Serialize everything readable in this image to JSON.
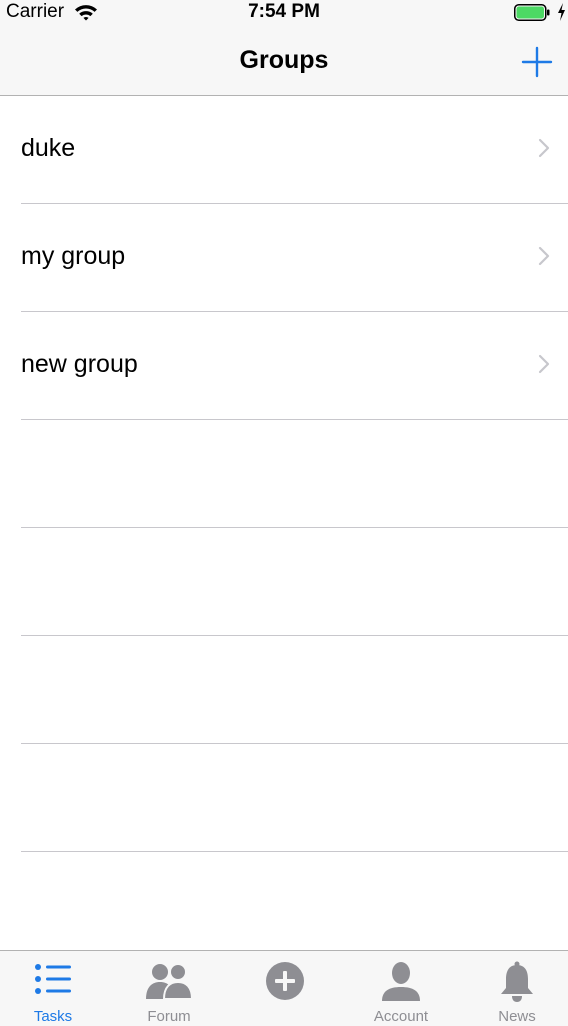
{
  "status_bar": {
    "carrier": "Carrier",
    "time": "7:54 PM"
  },
  "nav": {
    "title": "Groups",
    "add_icon": "plus-icon"
  },
  "groups": [
    {
      "name": "duke"
    },
    {
      "name": "my group"
    },
    {
      "name": "new group"
    }
  ],
  "tabs": [
    {
      "label": "Tasks",
      "icon": "list-icon",
      "active": true
    },
    {
      "label": "Forum",
      "icon": "people-icon",
      "active": false
    },
    {
      "label": "",
      "icon": "plus-circle-icon",
      "active": false
    },
    {
      "label": "Account",
      "icon": "person-icon",
      "active": false
    },
    {
      "label": "News",
      "icon": "bell-icon",
      "active": false
    }
  ],
  "colors": {
    "accent": "#1e7ae6",
    "inactive": "#8e8e93",
    "battery": "#4cd964"
  }
}
